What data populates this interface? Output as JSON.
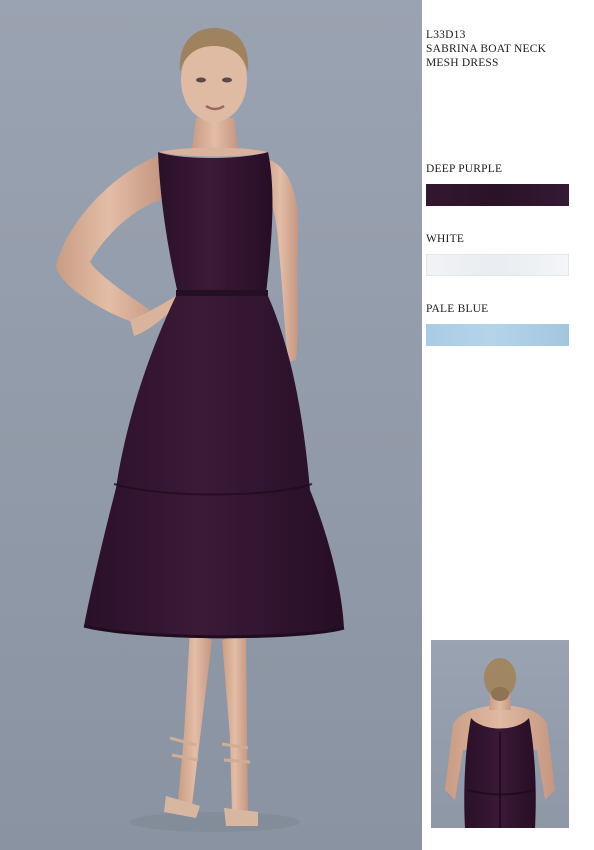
{
  "product": {
    "style_code": "L33D13",
    "style_name_line1": "SABRINA BOAT NECK",
    "style_name_line2": "MESH DRESS"
  },
  "colours": [
    {
      "label": "DEEP PURPLE",
      "hex": "#2e1530"
    },
    {
      "label": "WHITE",
      "hex": "#eef0f3"
    },
    {
      "label": "PALE BLUE",
      "hex": "#afd0e7"
    }
  ],
  "images": {
    "main": "model-front-photo",
    "detail": "model-back-photo"
  }
}
